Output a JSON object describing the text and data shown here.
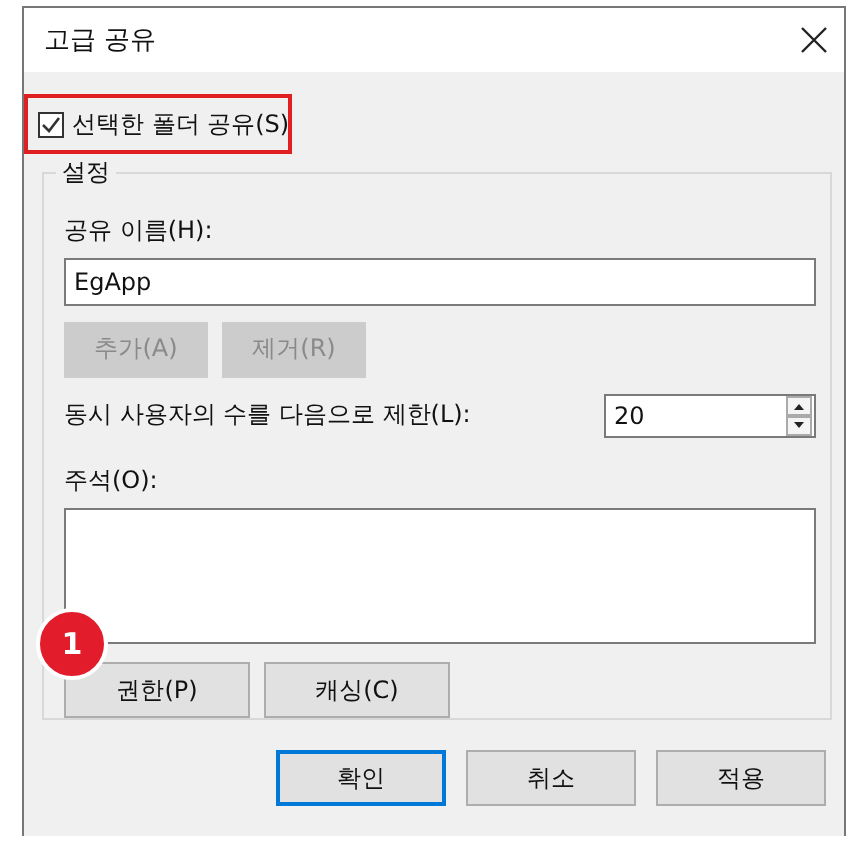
{
  "window": {
    "title": "고급 공유"
  },
  "share_checkbox": {
    "label": "선택한 폴더 공유(S)",
    "checked": true,
    "highlighted": true
  },
  "settings": {
    "title": "설정",
    "share_name": {
      "label": "공유 이름(H):",
      "value": "EgApp"
    },
    "name_buttons": [
      {
        "label": "추가(A)",
        "disabled": true
      },
      {
        "label": "제거(R)",
        "disabled": true
      }
    ],
    "user_limit": {
      "label": "동시 사용자의 수를 다음으로 제한(L):",
      "value": "20"
    },
    "comment": {
      "label": "주석(O):"
    },
    "badge": "1",
    "buttons": [
      {
        "label": "권한(P)",
        "disabled": false
      },
      {
        "label": "캐싱(C)",
        "disabled": false
      }
    ]
  },
  "footer_buttons": [
    {
      "label": "확인",
      "default": true
    },
    {
      "label": "취소",
      "default": false
    },
    {
      "label": "적용",
      "default": false
    }
  ]
}
